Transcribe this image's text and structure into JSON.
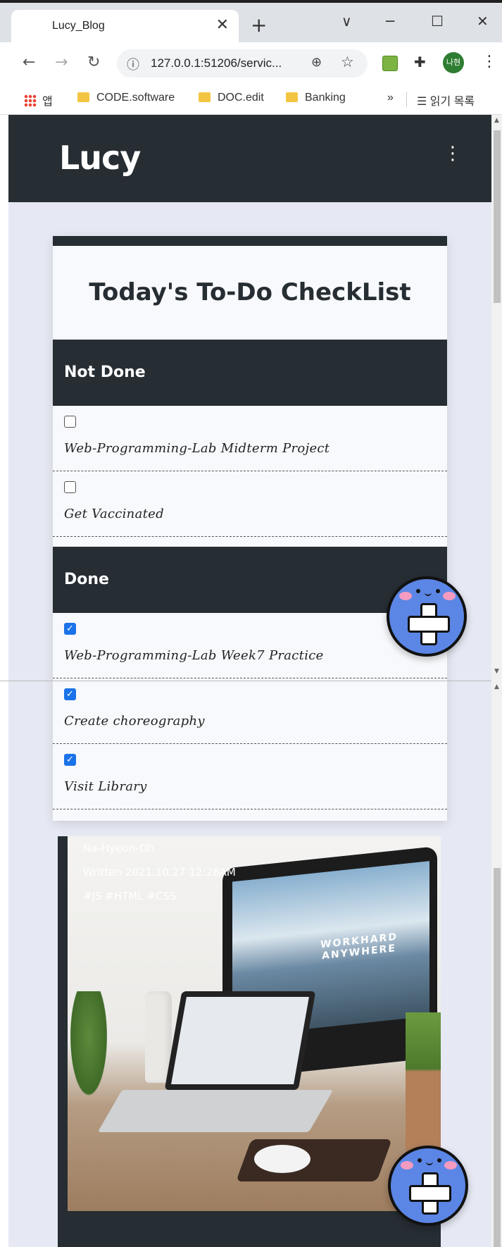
{
  "browser": {
    "tab_title": "Lucy_Blog",
    "tab_close": "✕",
    "new_tab": "+",
    "window_controls": [
      "∨",
      "─",
      "☐",
      "✕"
    ],
    "url": "127.0.0.1:51206/servic...",
    "profile_initials": "나현",
    "bookmarks": {
      "apps": "앱",
      "items": [
        "CODE.software",
        "DOC.edit",
        "Banking"
      ],
      "more": "»",
      "reading_list": "읽기 목록"
    }
  },
  "site": {
    "brand": "Lucy",
    "menu_icon": "⋮"
  },
  "todo": {
    "title": "Today's To-Do CheckList",
    "not_done_heading": "Not Done",
    "done_heading": "Done",
    "not_done": [
      {
        "label": "Web-Programming-Lab Midterm Project",
        "checked": false
      },
      {
        "label": "Get Vaccinated",
        "checked": false
      }
    ],
    "done": [
      {
        "label": "Web-Programming-Lab Week7 Practice",
        "checked": true
      },
      {
        "label": "Create choreography",
        "checked": true
      },
      {
        "label": "Visit Library",
        "checked": true
      }
    ]
  },
  "post": {
    "author": "Na-Hyeon-Oh",
    "written": "Written 2021.10.27 12:28AM",
    "tags": "#JS #HTML #CSS",
    "screen_text": "WORKHARD ANYWHERE"
  },
  "fab": {
    "icon": "add-icon"
  },
  "colors": {
    "header_bg": "#262d33",
    "page_bg": "#e6e9f3",
    "fab": "#5b86e5",
    "checkbox_checked": "#1a73e8"
  }
}
